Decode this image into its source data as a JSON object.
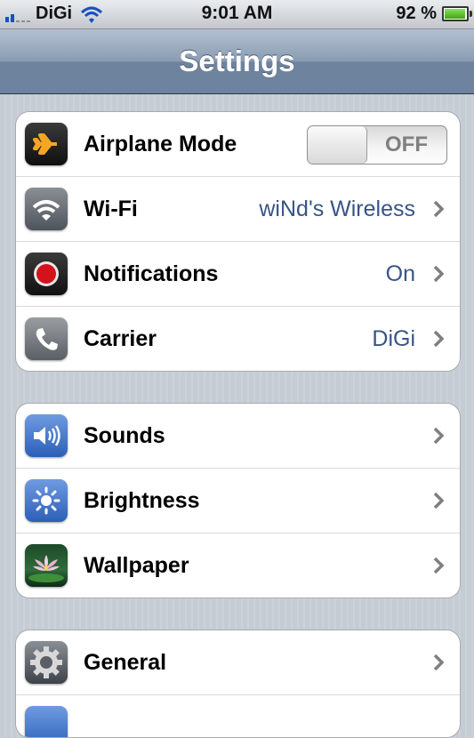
{
  "status_bar": {
    "carrier": "DiGi",
    "time": "9:01 AM",
    "battery_percent": "92 %",
    "battery_level": 0.92,
    "signal_bars_active": 2,
    "signal_bars_total": 5
  },
  "nav": {
    "title": "Settings"
  },
  "groups": [
    {
      "rows": [
        {
          "id": "airplane",
          "label": "Airplane Mode",
          "icon": "airplane-icon",
          "toggle": "OFF"
        },
        {
          "id": "wifi",
          "label": "Wi-Fi",
          "value": "wiNd's Wireless",
          "icon": "wifi-icon"
        },
        {
          "id": "notifications",
          "label": "Notifications",
          "value": "On",
          "icon": "notifications-icon"
        },
        {
          "id": "carrier",
          "label": "Carrier",
          "value": "DiGi",
          "icon": "phone-icon"
        }
      ]
    },
    {
      "rows": [
        {
          "id": "sounds",
          "label": "Sounds",
          "icon": "speaker-icon"
        },
        {
          "id": "brightness",
          "label": "Brightness",
          "icon": "sun-icon"
        },
        {
          "id": "wallpaper",
          "label": "Wallpaper",
          "icon": "flower-icon"
        }
      ]
    },
    {
      "rows": [
        {
          "id": "general",
          "label": "General",
          "icon": "gear-icon"
        }
      ]
    }
  ],
  "colors": {
    "value_text": "#385487",
    "nav_bar": "#6e839d",
    "background": "#c5ccd4"
  }
}
